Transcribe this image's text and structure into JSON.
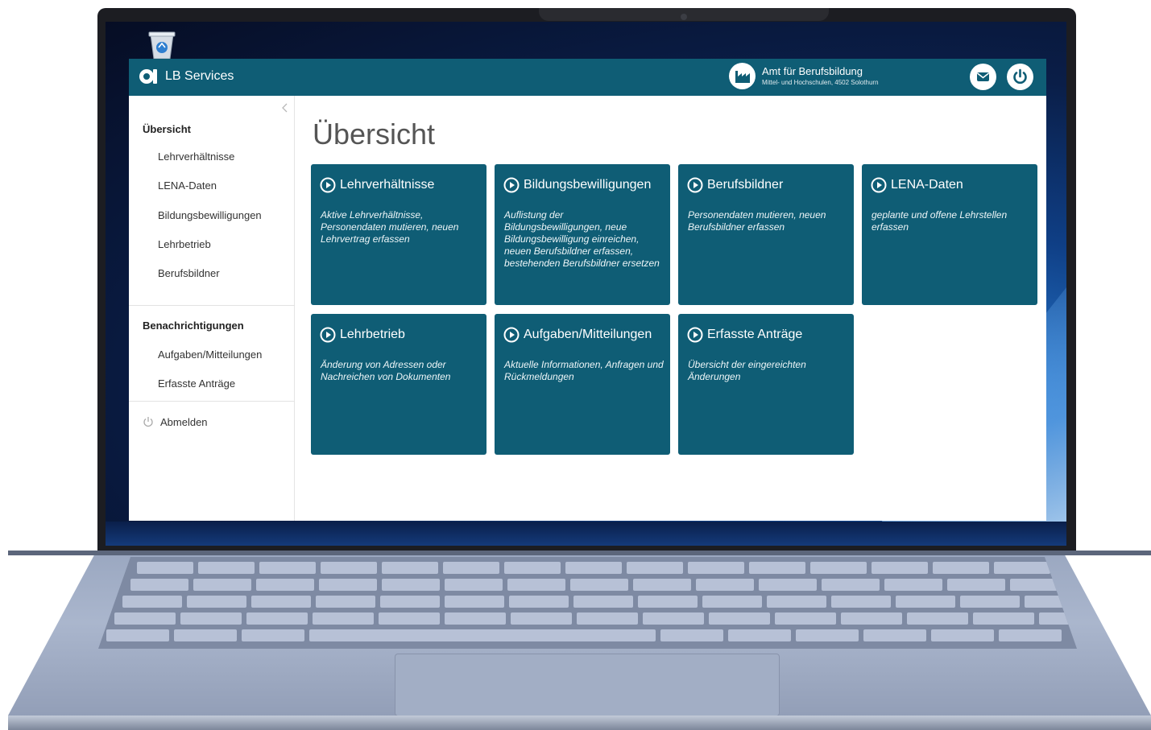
{
  "header": {
    "app_title": "LB Services",
    "org_name": "Amt für Berufsbildung",
    "org_sub": "Mittel- und Hochschulen, 4502 Solothurn"
  },
  "sidebar": {
    "section_overview": "Übersicht",
    "overview_items": [
      {
        "label": "Lehrverhältnisse"
      },
      {
        "label": "LENA-Daten"
      },
      {
        "label": "Bildungsbewilligungen"
      },
      {
        "label": "Lehrbetrieb"
      },
      {
        "label": "Berufsbildner"
      }
    ],
    "section_notifications": "Benachrichtigungen",
    "notification_items": [
      {
        "label": "Aufgaben/Mitteilungen"
      },
      {
        "label": "Erfasste Anträge"
      }
    ],
    "logout": "Abmelden"
  },
  "main": {
    "title": "Übersicht",
    "tiles": [
      {
        "title": "Lehrverhältnisse",
        "desc": "Aktive Lehrverhältnisse, Personendaten mutieren, neuen Lehrvertrag erfassen"
      },
      {
        "title": "Bildungsbewilligungen",
        "desc": "Auflistung der Bildungsbewilligungen, neue Bildungsbewilligung einreichen, neuen Berufsbildner erfassen, bestehenden Berufsbildner ersetzen"
      },
      {
        "title": "Berufsbildner",
        "desc": "Personendaten mutieren, neuen Berufsbildner erfassen"
      },
      {
        "title": "LENA-Daten",
        "desc": "geplante und offene Lehrstellen erfassen"
      },
      {
        "title": "Lehrbetrieb",
        "desc": "Änderung von Adressen oder Nachreichen von Dokumenten"
      },
      {
        "title": "Aufgaben/Mitteilungen",
        "desc": "Aktuelle Informationen, Anfragen und Rückmeldungen"
      },
      {
        "title": "Erfasste Anträge",
        "desc": "Übersicht der eingereichten Änderungen"
      }
    ]
  },
  "colors": {
    "brand": "#0f5d75",
    "tile": "#0f5d75",
    "header_text": "#ffffff"
  },
  "icons": [
    "recycle-bin-icon",
    "logo-icon",
    "factory-icon",
    "mail-icon",
    "power-icon",
    "chevron-left-icon",
    "play-circle-icon"
  ]
}
